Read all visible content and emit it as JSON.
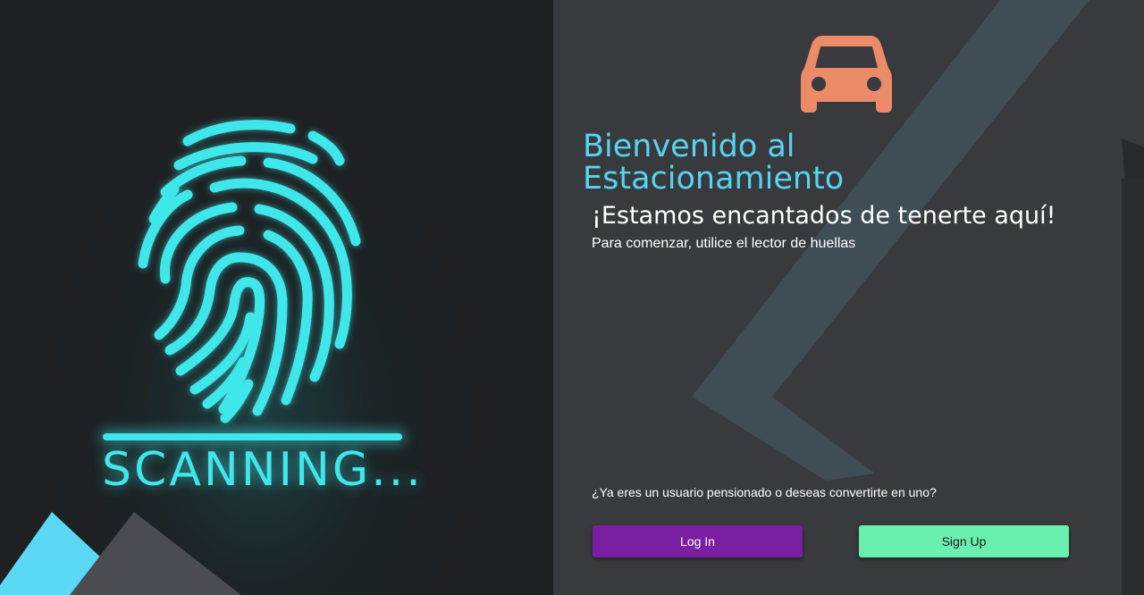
{
  "scanner": {
    "label": "SCANNING...",
    "accent_color": "#3fe6ea",
    "icon": "fingerprint-icon"
  },
  "welcome": {
    "icon": "car-icon",
    "icon_color": "#ec8b68",
    "title": "Bienvenido al Estacionamiento",
    "title_color": "#56d4f2",
    "subtitle": "¡Estamos encantados de tenerte aquí!",
    "hint": "Para comenzar, utilice el lector de huellas"
  },
  "account": {
    "question": "¿Ya eres un usuario pensionado o deseas convertirte en uno?",
    "login_label": "Log In",
    "login_color": "#7b1fa2",
    "signup_label": "Sign Up",
    "signup_color": "#69f0ae"
  }
}
